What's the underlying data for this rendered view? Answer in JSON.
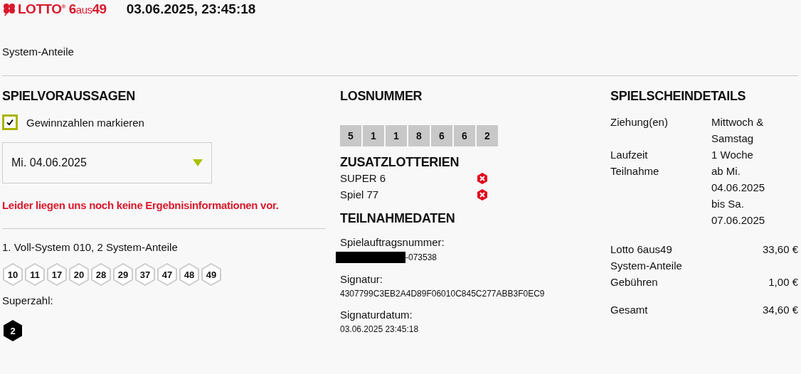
{
  "header": {
    "logo": {
      "brand": "LOTTO",
      "registered": "®",
      "game_number": "6",
      "game_word": "aus",
      "game_suffix": "49"
    },
    "timestamp": "03.06.2025, 23:45:18"
  },
  "subtitle": "System-Anteile",
  "predictions": {
    "title": "SPIELVORAUSSAGEN",
    "checkbox": {
      "label": "Gewinnzahlen markieren",
      "checked": true
    },
    "date_select": {
      "value": "Mi. 04.06.2025"
    },
    "notice": "Leider liegen uns noch keine Ergebnisinformationen vor.",
    "system": {
      "title": "1. Voll-System 010, 2 System-Anteile",
      "numbers": [
        "10",
        "11",
        "17",
        "20",
        "28",
        "29",
        "37",
        "47",
        "48",
        "49"
      ],
      "superzahl_label": "Superzahl:",
      "superzahl": "2"
    }
  },
  "ticket": {
    "title": "LOSNUMMER",
    "digits": [
      "5",
      "1",
      "1",
      "8",
      "6",
      "6",
      "2"
    ],
    "extra_title": "ZUSATZLOTTERIEN",
    "extras": [
      {
        "name": "SUPER 6",
        "active": false
      },
      {
        "name": "Spiel 77",
        "active": false
      }
    ],
    "participation_title": "TEILNAHMEDATEN",
    "fields": [
      {
        "label": "Spielauftragsnummer:",
        "value": "-073538",
        "redacted": true
      },
      {
        "label": "Signatur:",
        "value": "4307799C3EB2A4D89F06010C845C277ABB3F0EC9",
        "redacted": false
      },
      {
        "label": "Signaturdatum:",
        "value": "03.06.2025 23:45:18",
        "redacted": false
      }
    ]
  },
  "details": {
    "title": "SPIELSCHEINDETAILS",
    "info": [
      {
        "label": "Ziehung(en)",
        "value": "Mittwoch & Samstag"
      },
      {
        "label": "Laufzeit",
        "value": "1 Woche"
      },
      {
        "label": "Teilnahme",
        "value": "ab Mi. 04.06.2025 bis Sa. 07.06.2025"
      }
    ],
    "costs": [
      {
        "label": "Lotto 6aus49 System-Anteile",
        "amount": "33,60 €"
      },
      {
        "label": "Gebühren",
        "amount": "1,00 €"
      }
    ],
    "total": {
      "label": "Gesamt",
      "amount": "34,60 €"
    }
  }
}
